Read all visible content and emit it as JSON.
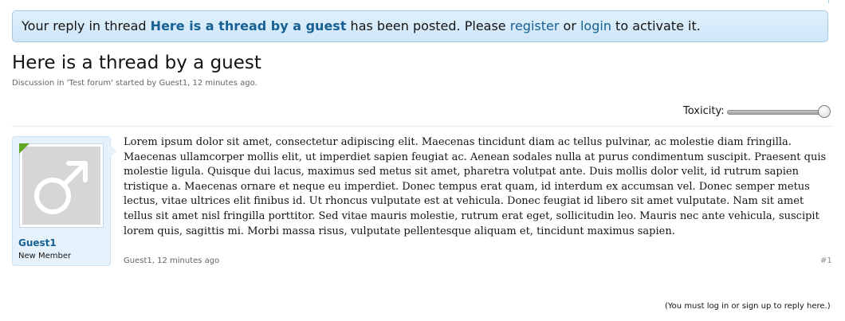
{
  "notice": {
    "prefix": "Your reply in thread ",
    "thread_link": "Here is a thread by a guest",
    "middle": " has been posted. Please ",
    "register_link": "register",
    "or": " or ",
    "login_link": "login",
    "suffix": " to activate it."
  },
  "thread": {
    "title": "Here is a thread by a guest",
    "meta": "Discussion in 'Test forum' started by Guest1, 12 minutes ago."
  },
  "toxicity": {
    "label": "Toxicity:",
    "value_fraction": 1.0
  },
  "post": {
    "author_name": "Guest1",
    "author_title": "New Member",
    "avatar_icon": "male-symbol-icon",
    "body": "Lorem ipsum dolor sit amet, consectetur adipiscing elit. Maecenas tincidunt diam ac tellus pulvinar, ac molestie diam fringilla. Maecenas ullamcorper mollis elit, ut imperdiet sapien feugiat ac. Aenean sodales nulla at purus condimentum suscipit. Praesent quis molestie ligula. Quisque dui lacus, maximus sed metus sit amet, pharetra volutpat ante. Duis mollis dolor velit, id rutrum sapien tristique a. Maecenas ornare et neque eu imperdiet. Donec tempus erat quam, id interdum ex accumsan vel. Donec semper metus lectus, vitae ultrices elit finibus id. Ut rhoncus vulputate est at vehicula. Donec feugiat id libero sit amet vulputate. Nam sit amet tellus sit amet nisl fringilla porttitor. Sed vitae mauris molestie, rutrum erat eget, sollicitudin leo. Mauris nec ante vehicula, suscipit lorem quis, sagittis mi. Morbi massa risus, vulputate pellentesque aliquam et, tincidunt maximus sapien.",
    "meta": "Guest1, 12 minutes ago",
    "number": "#1"
  },
  "footer": {
    "note": "(You must log in or sign up to reply here.)"
  },
  "colors": {
    "link": "#176093",
    "notice_bg": "#dff0fc",
    "online": "#5fa623"
  }
}
